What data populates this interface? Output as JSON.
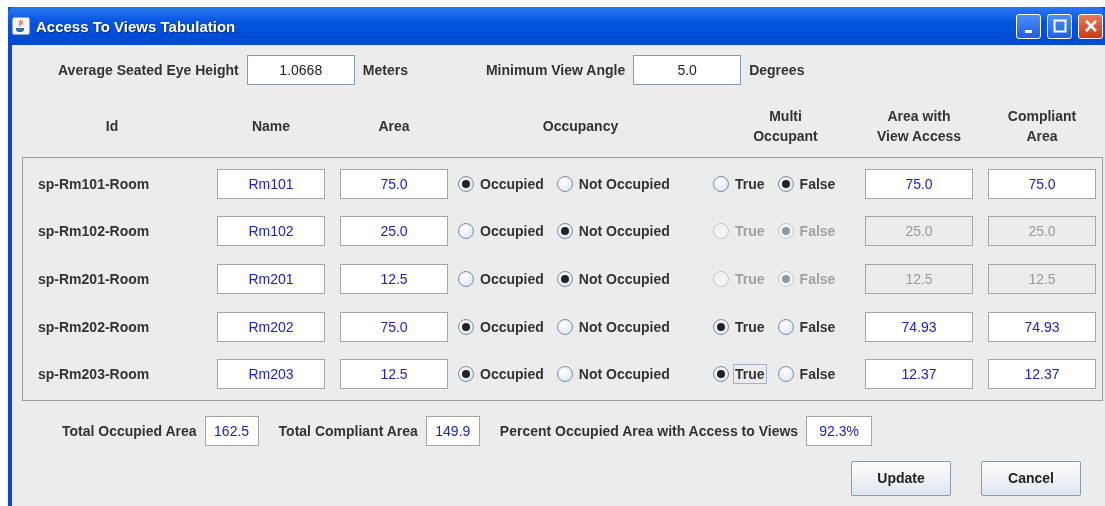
{
  "window": {
    "title": "Access To Views Tabulation"
  },
  "settings": [
    {
      "label": "Average Seated Eye Height",
      "value": "1.0668",
      "unit": "Meters"
    },
    {
      "label": "Minimum View Angle",
      "value": "5.0",
      "unit": "Degrees"
    }
  ],
  "columns": [
    "Id",
    "Name",
    "Area",
    "Occupancy",
    "Multi Occupant",
    "Area with View Access",
    "Compliant Area"
  ],
  "rows": [
    {
      "id": "sp-Rm101-Room",
      "name": "Rm101",
      "area": "75.0",
      "occupancy": [
        {
          "label": "Occupied",
          "selected": true
        },
        {
          "label": "Not Occupied",
          "selected": false
        }
      ],
      "disabled": false,
      "multi": [
        {
          "label": "True",
          "selected": false,
          "focused": false
        },
        {
          "label": "False",
          "selected": true,
          "focused": false
        }
      ],
      "area_with_view_access": "75.0",
      "compliant_area": "75.0"
    },
    {
      "id": "sp-Rm102-Room",
      "name": "Rm102",
      "area": "25.0",
      "occupancy": [
        {
          "label": "Occupied",
          "selected": false
        },
        {
          "label": "Not Occupied",
          "selected": true
        }
      ],
      "disabled": true,
      "multi": [
        {
          "label": "True",
          "selected": false,
          "focused": false
        },
        {
          "label": "False",
          "selected": true,
          "focused": false
        }
      ],
      "area_with_view_access": "25.0",
      "compliant_area": "25.0"
    },
    {
      "id": "sp-Rm201-Room",
      "name": "Rm201",
      "area": "12.5",
      "occupancy": [
        {
          "label": "Occupied",
          "selected": false
        },
        {
          "label": "Not Occupied",
          "selected": true
        }
      ],
      "disabled": true,
      "multi": [
        {
          "label": "True",
          "selected": false,
          "focused": false
        },
        {
          "label": "False",
          "selected": true,
          "focused": false
        }
      ],
      "area_with_view_access": "12.5",
      "compliant_area": "12.5"
    },
    {
      "id": "sp-Rm202-Room",
      "name": "Rm202",
      "area": "75.0",
      "occupancy": [
        {
          "label": "Occupied",
          "selected": true
        },
        {
          "label": "Not Occupied",
          "selected": false
        }
      ],
      "disabled": false,
      "multi": [
        {
          "label": "True",
          "selected": true,
          "focused": false
        },
        {
          "label": "False",
          "selected": false,
          "focused": false
        }
      ],
      "area_with_view_access": "74.93",
      "compliant_area": "74.93"
    },
    {
      "id": "sp-Rm203-Room",
      "name": "Rm203",
      "area": "12.5",
      "occupancy": [
        {
          "label": "Occupied",
          "selected": true
        },
        {
          "label": "Not Occupied",
          "selected": false
        }
      ],
      "disabled": false,
      "multi": [
        {
          "label": "True",
          "selected": true,
          "focused": true
        },
        {
          "label": "False",
          "selected": false,
          "focused": false
        }
      ],
      "area_with_view_access": "12.37",
      "compliant_area": "12.37"
    }
  ],
  "totals": [
    {
      "label": "Total Occupied Area",
      "value": "162.5"
    },
    {
      "label": "Total Compliant Area",
      "value": "149.9"
    },
    {
      "label": "Percent Occupied Area with Access to Views",
      "value": "92.3%"
    }
  ],
  "buttons": [
    "Update",
    "Cancel"
  ]
}
